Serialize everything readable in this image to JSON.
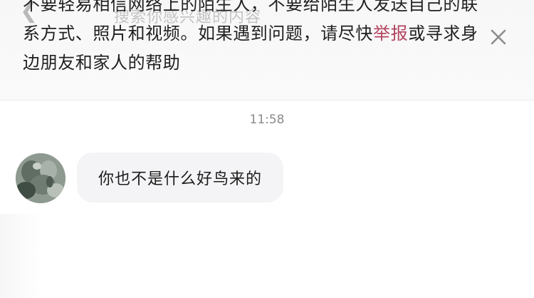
{
  "header": {
    "back_icon": "chevron-left-icon",
    "search_placeholder": "搜索你感兴趣的内容"
  },
  "notice": {
    "text_before": "不要轻易相信网络上的陌生人，不要给陌生人发送自己的联系方式、照片和视频。如果遇到问题，请尽快",
    "report_link": "举报",
    "text_after": "或寻求身边朋友和家人的帮助",
    "close_icon": "close-icon",
    "link_color": "#b2435f"
  },
  "chat": {
    "timestamp": "11:58",
    "messages": [
      {
        "sender": "other",
        "avatar_icon": "avatar",
        "text": "你也不是什么好鸟来的"
      }
    ]
  }
}
